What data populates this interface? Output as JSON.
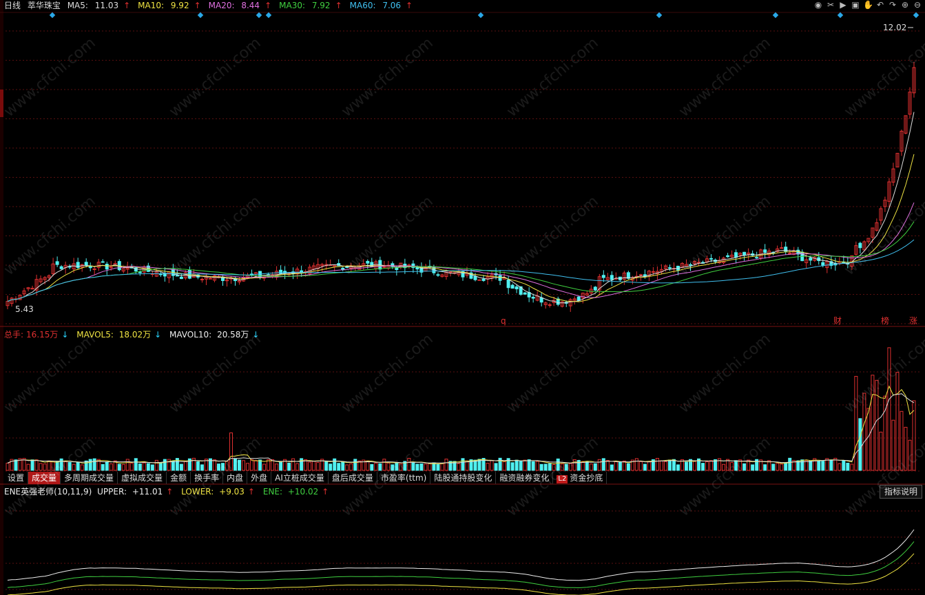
{
  "header": {
    "period": "日线",
    "stock_name": "萃华珠宝",
    "ma": [
      {
        "label": "MA5:",
        "value": "11.03",
        "arrow": "↑",
        "color": "#dddddd"
      },
      {
        "label": "MA10:",
        "value": "9.92",
        "arrow": "↑",
        "color": "#f0e442"
      },
      {
        "label": "MA20:",
        "value": "8.44",
        "arrow": "↑",
        "color": "#e070e0"
      },
      {
        "label": "MA30:",
        "value": "7.92",
        "arrow": "↑",
        "color": "#40d040"
      },
      {
        "label": "MA60:",
        "value": "7.06",
        "arrow": "↑",
        "color": "#40c0f0"
      }
    ]
  },
  "toolbar": {
    "icons": [
      "eye-icon",
      "scissors-icon",
      "play-icon",
      "lock-icon",
      "hand-icon",
      "back-icon",
      "back2-icon",
      "plus-icon",
      "minus-icon"
    ]
  },
  "price_labels": {
    "high": "12.02",
    "low": "5.43"
  },
  "signals": [
    {
      "text": "q",
      "key": "q"
    },
    {
      "text": "财",
      "key": "cai"
    },
    {
      "text": "榜",
      "key": "bang"
    },
    {
      "text": "涨",
      "key": "zhang"
    }
  ],
  "volume": {
    "total_label": "总手:",
    "total_value": "16.15万",
    "total_arrow": "↓",
    "mavol5_label": "MAVOL5:",
    "mavol5_value": "18.02万",
    "mavol5_arrow": "↓",
    "mavol10_label": "MAVOL10:",
    "mavol10_value": "20.58万",
    "mavol10_arrow": "↓"
  },
  "tabs": [
    {
      "label": "设置",
      "active": false
    },
    {
      "label": "成交量",
      "active": true
    },
    {
      "label": "多周期成交量",
      "active": false
    },
    {
      "label": "虚拟成交量",
      "active": false
    },
    {
      "label": "金额",
      "active": false
    },
    {
      "label": "换手率",
      "active": false
    },
    {
      "label": "内盘",
      "active": false
    },
    {
      "label": "外盘",
      "active": false
    },
    {
      "label": "AI立桩成交量",
      "active": false
    },
    {
      "label": "盘后成交量",
      "active": false
    },
    {
      "label": "市盈率(ttm)",
      "active": false
    },
    {
      "label": "陆股通持股变化",
      "active": false
    },
    {
      "label": "融资融券变化",
      "active": false
    },
    {
      "label": "资金抄底",
      "active": false,
      "badge": "L2"
    }
  ],
  "indicator": {
    "name": "ENE英强老师(10,11,9)",
    "upper_label": "UPPER:",
    "upper_value": "+11.01",
    "upper_arrow": "↑",
    "lower_label": "LOWER:",
    "lower_value": "+9.03",
    "lower_arrow": "↑",
    "ene_label": "ENE:",
    "ene_value": "+10.02",
    "ene_arrow": "↑",
    "help_label": "指标说明"
  },
  "watermark": "www.cfchi.com",
  "colors": {
    "up": "#e03030",
    "down": "#50f0f0",
    "grid": "#5a0f0f",
    "bg": "#000000"
  }
}
